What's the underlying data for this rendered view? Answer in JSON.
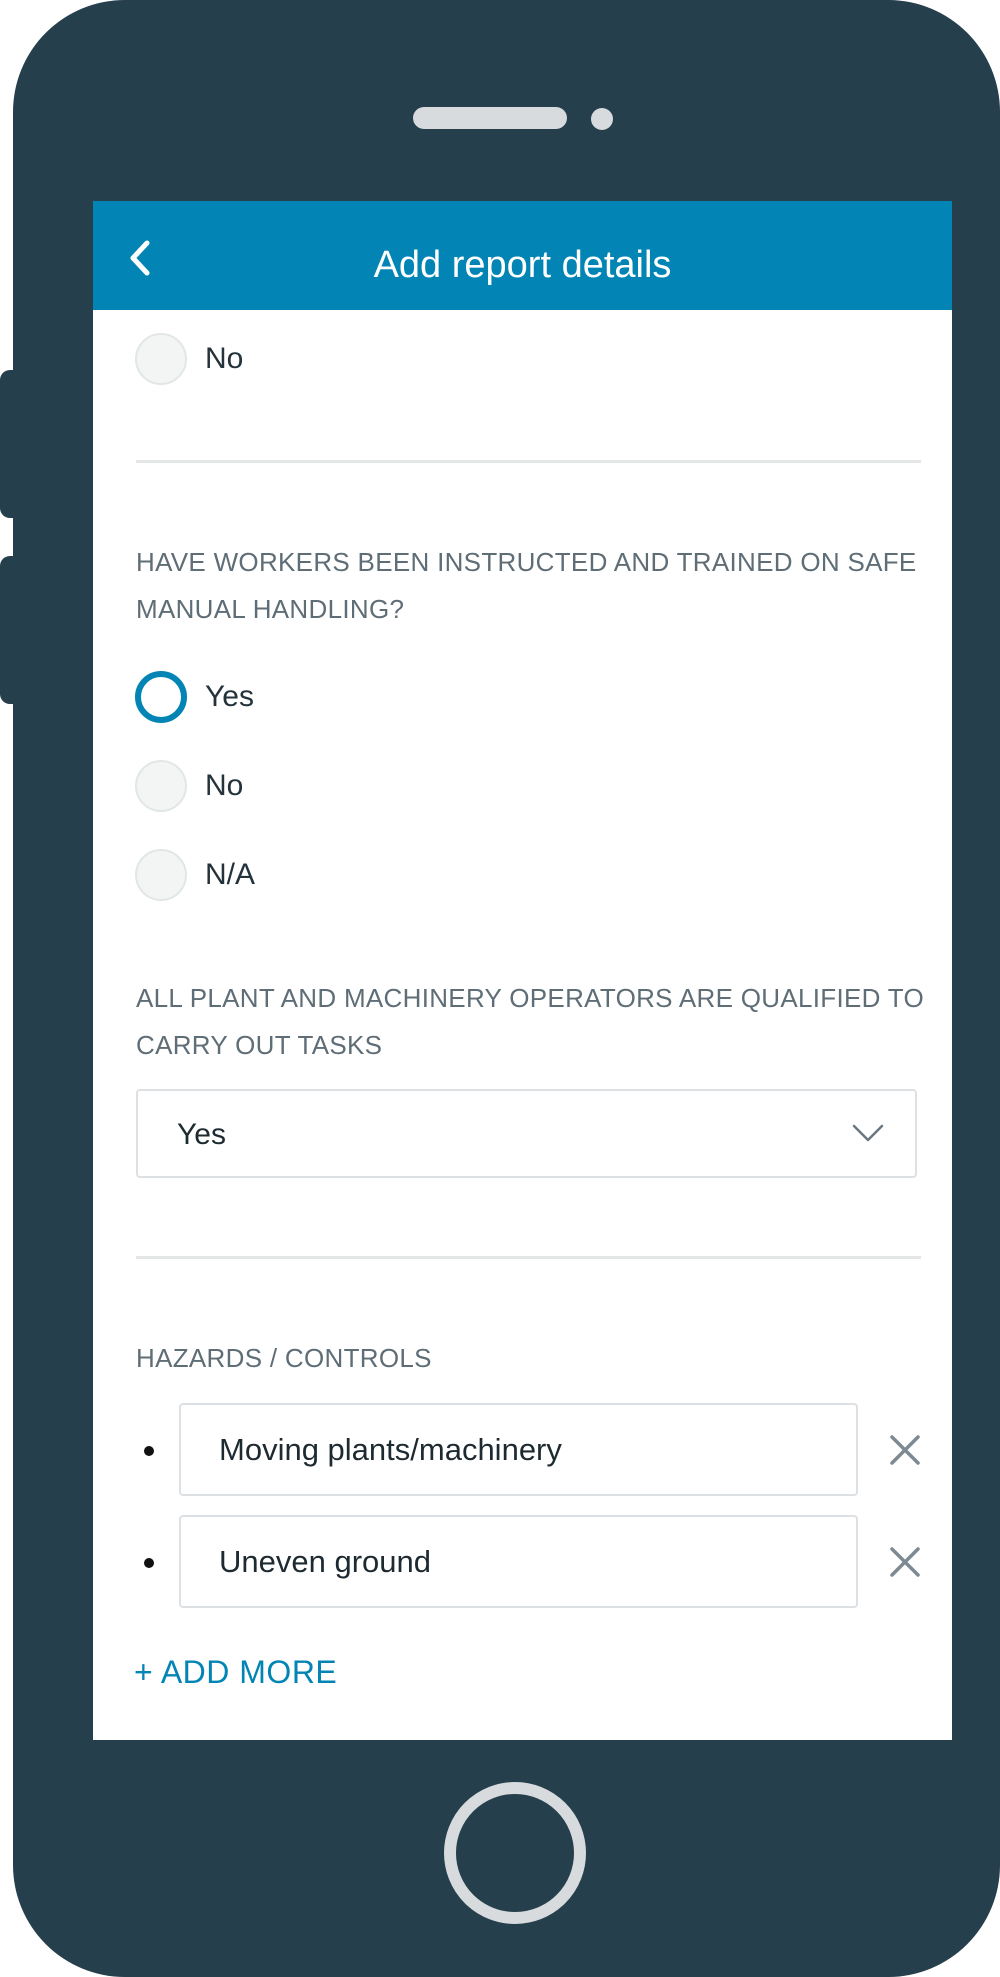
{
  "app_bar": {
    "title": "Add report details",
    "back_icon": "chevron-left-icon"
  },
  "previous_question": {
    "options": [
      {
        "label": "No",
        "selected": false
      }
    ]
  },
  "manual_handling_question": {
    "label": "HAVE WORKERS BEEN INSTRUCTED AND TRAINED ON SAFE MANUAL HANDLING?",
    "options": [
      {
        "label": "Yes",
        "selected": true
      },
      {
        "label": "No",
        "selected": false
      },
      {
        "label": "N/A",
        "selected": false
      }
    ]
  },
  "operators_question": {
    "label": "ALL PLANT AND MACHINERY OPERATORS ARE QUALIFIED TO CARRY OUT TASKS",
    "selected_value": "Yes",
    "dropdown_icon": "chevron-down-icon"
  },
  "hazards": {
    "label": "HAZARDS / CONTROLS",
    "items": [
      {
        "value": "Moving plants/machinery"
      },
      {
        "value": "Uneven ground"
      }
    ],
    "remove_icon": "close-icon",
    "add_more_label": "+ ADD MORE"
  },
  "colors": {
    "accent": "#0285b4",
    "device_frame": "#263f4c",
    "question_text": "#5f6d76"
  }
}
